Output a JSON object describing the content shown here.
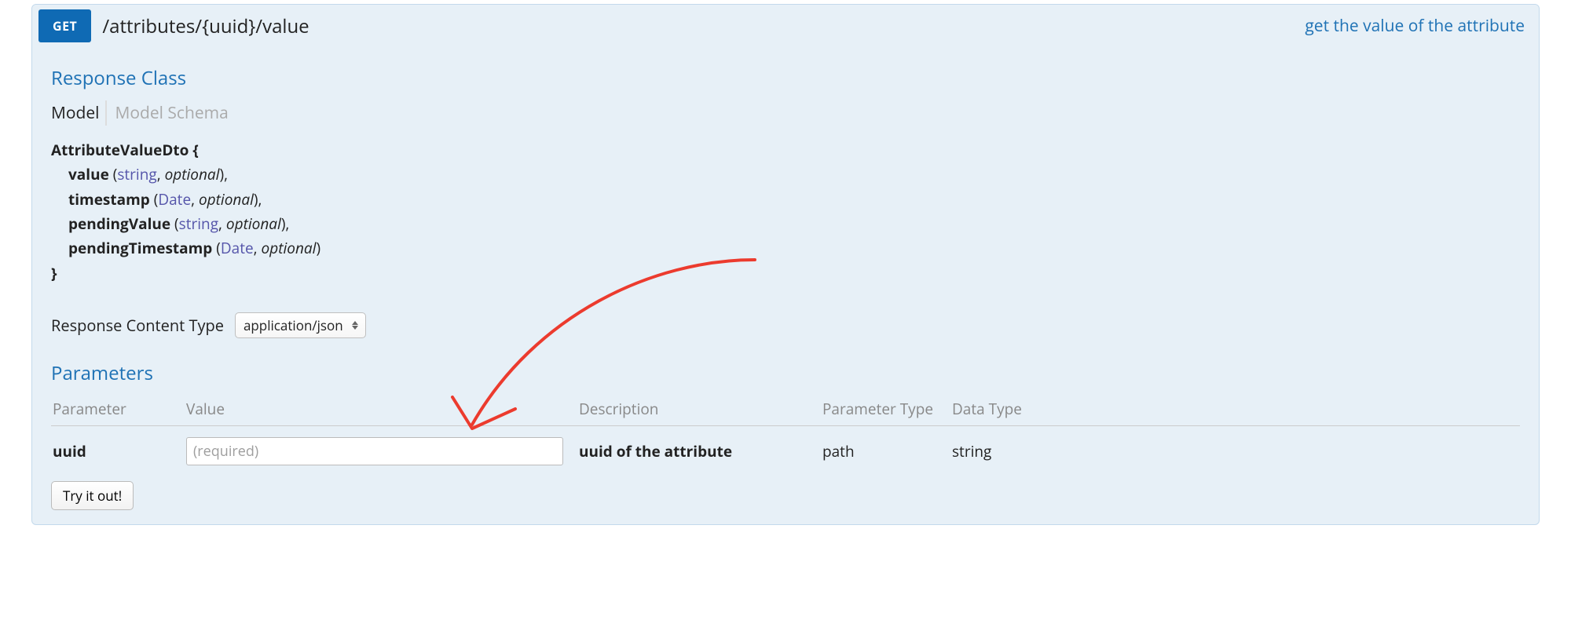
{
  "header": {
    "method": "GET",
    "path": "/attributes/{uuid}/value",
    "summary": "get the value of the attribute"
  },
  "sections": {
    "response_class_title": "Response Class",
    "parameters_title": "Parameters"
  },
  "tabs": {
    "model": "Model",
    "model_schema": "Model Schema"
  },
  "model": {
    "name": "AttributeValueDto",
    "open_brace": " {",
    "close_brace": "}",
    "props": [
      {
        "name": "value",
        "type": "string",
        "optional": "optional"
      },
      {
        "name": "timestamp",
        "type": "Date",
        "optional": "optional"
      },
      {
        "name": "pendingValue",
        "type": "string",
        "optional": "optional"
      },
      {
        "name": "pendingTimestamp",
        "type": "Date",
        "optional": "optional"
      }
    ]
  },
  "response_content_type": {
    "label": "Response Content Type",
    "selected": "application/json"
  },
  "params_headers": {
    "parameter": "Parameter",
    "value": "Value",
    "description": "Description",
    "parameter_type": "Parameter Type",
    "data_type": "Data Type"
  },
  "params": [
    {
      "name": "uuid",
      "placeholder": "(required)",
      "value_current": "",
      "description": "uuid of the attribute",
      "param_type": "path",
      "data_type": "string"
    }
  ],
  "buttons": {
    "try_it_out": "Try it out!"
  },
  "colors": {
    "method_bg": "#0f6ab4",
    "panel_bg": "#e7f0f7",
    "link": "#1f72b5",
    "annotation": "#ec3b2e"
  }
}
